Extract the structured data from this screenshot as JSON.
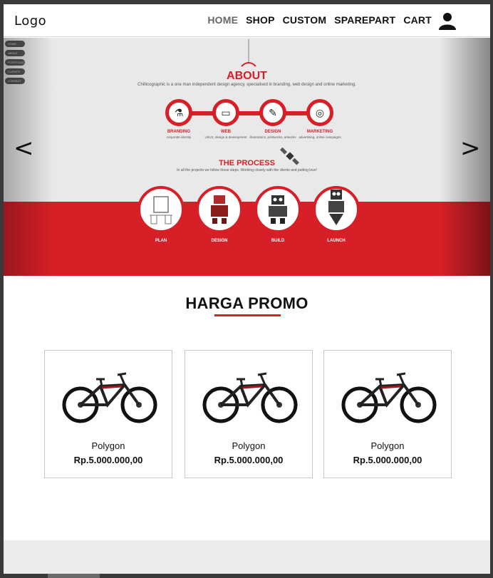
{
  "header": {
    "logo": "Logo",
    "nav": [
      "HOME",
      "SHOP",
      "CUSTOM",
      "SPAREPART",
      "CART"
    ],
    "active_nav": "HOME"
  },
  "slider": {
    "prev_glyph": "<",
    "next_glyph": ">",
    "mini_menu": [
      "HOME",
      "ABOUT",
      "PORTFOLIO",
      "CLIENTS",
      "CONTACT"
    ],
    "about_title": "ABOUT",
    "about_desc": "Chillicographic is a one man independent design agency, specialised in branding, web design and online marketing.",
    "services": [
      {
        "label": "BRANDING",
        "sub": "corporate identity"
      },
      {
        "label": "WEB",
        "sub": "UI/UX, design & development"
      },
      {
        "label": "DESIGN",
        "sub": "illustrations, printworks, artworks"
      },
      {
        "label": "MARKETING",
        "sub": "advertising, online campaigns"
      }
    ],
    "process_title": "THE PROCESS",
    "process_desc": "In all the projects we follow these steps. Working closely with the clients and putting love!",
    "process_steps": [
      "PLAN",
      "DESIGN",
      "BUILD",
      "LAUNCH"
    ],
    "brand_color": "#d71f27"
  },
  "promo": {
    "title": "HARGA PROMO",
    "products": [
      {
        "name": "Polygon",
        "price": "Rp.5.000.000,00"
      },
      {
        "name": "Polygon",
        "price": "Rp.5.000.000,00"
      },
      {
        "name": "Polygon",
        "price": "Rp.5.000.000,00"
      }
    ]
  }
}
